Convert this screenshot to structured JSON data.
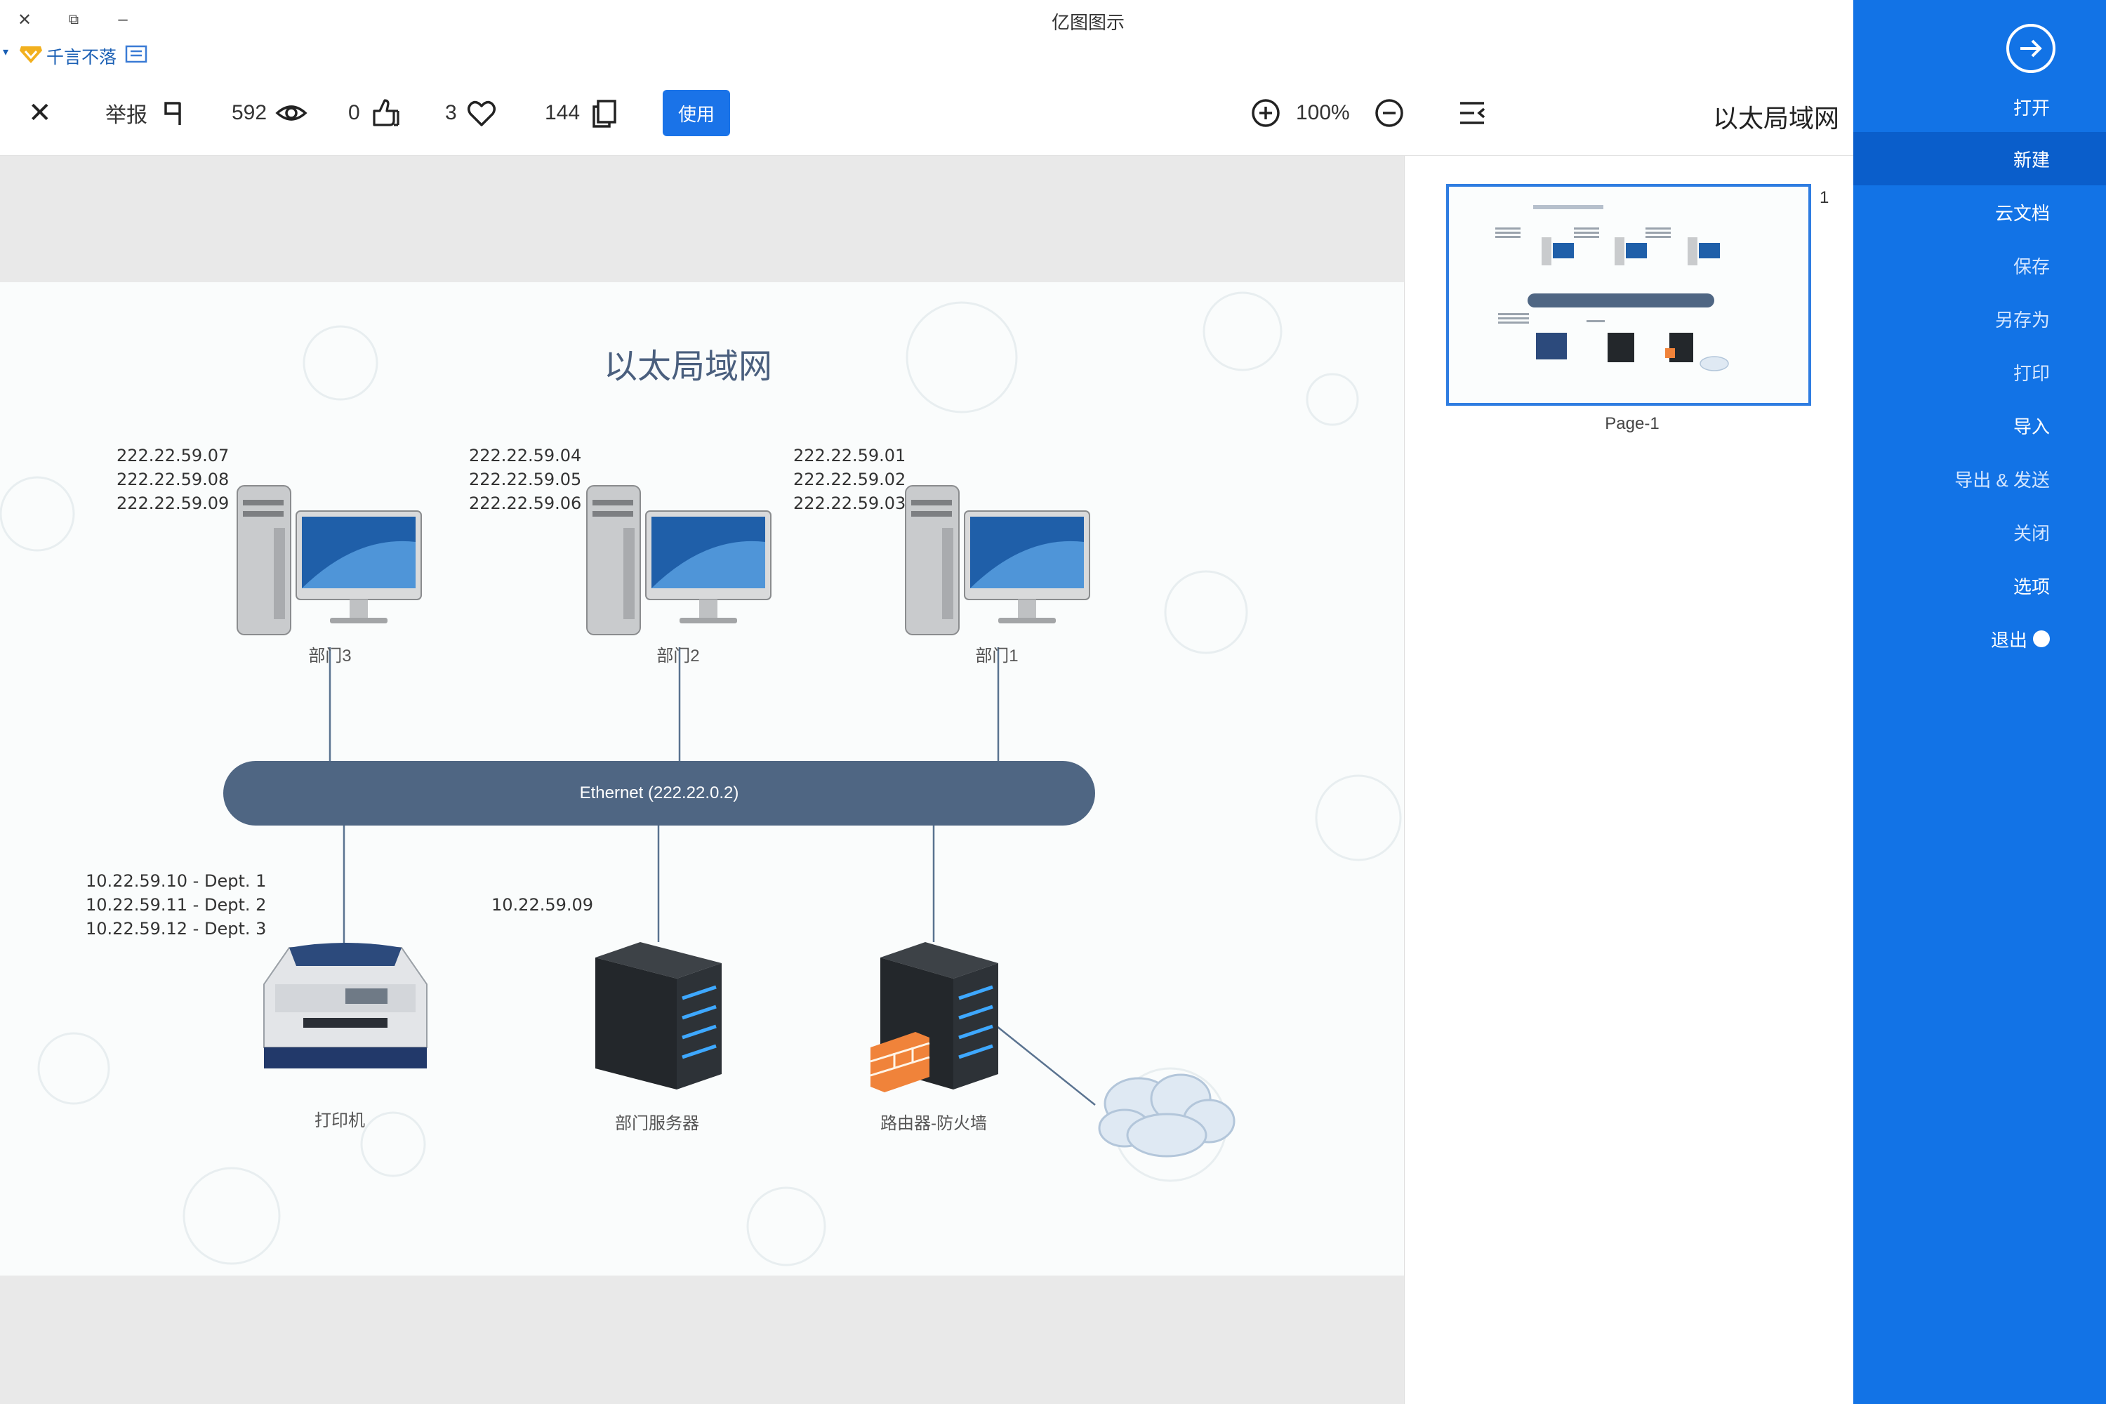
{
  "window": {
    "title": "亿图图示",
    "close_glyph": "✕",
    "restore_glyph": "⧉",
    "minimize_glyph": "–"
  },
  "menubar": {
    "vip_text": "千言不落"
  },
  "toolbar": {
    "close_glyph": "✕",
    "report_label": "举报",
    "views": "592",
    "likes": "0",
    "favorites": "3",
    "copies": "144",
    "use_label": "使用",
    "zoom": "100%",
    "doc_title": "以太局域网"
  },
  "diagram": {
    "title": "以太局域网",
    "ip_groups": [
      "222.22.59.07\n222.22.59.08\n222.22.59.09",
      "222.22.59.04\n222.22.59.05\n222.22.59.06",
      "222.22.59.01\n222.22.59.02\n222.22.59.03"
    ],
    "computers": [
      "部门3",
      "部门2",
      "部门1"
    ],
    "ethernet_label": "Ethernet (222.22.0.2)",
    "printer_ips": "10.22.59.10 - Dept. 1\n10.22.59.11 - Dept. 2\n10.22.59.12 - Dept. 3",
    "server_ip": "10.22.59.09",
    "printer_label": "打印机",
    "server_label": "部门服务器",
    "router_label": "路由器-防火墙"
  },
  "pages_panel": {
    "page_number": "1",
    "page_label": "Page-1"
  },
  "sidebar": {
    "items": [
      "打开",
      "新建",
      "云文档",
      "保存",
      "另存为",
      "打印",
      "导入",
      "导出 & 发送",
      "关闭",
      "选项",
      "退出"
    ],
    "active_index": 1
  },
  "colors": {
    "accent": "#1273e6",
    "sidebar_active": "#0a5ecb",
    "ethernet": "#4f6683",
    "title": "#4a5f7e"
  }
}
